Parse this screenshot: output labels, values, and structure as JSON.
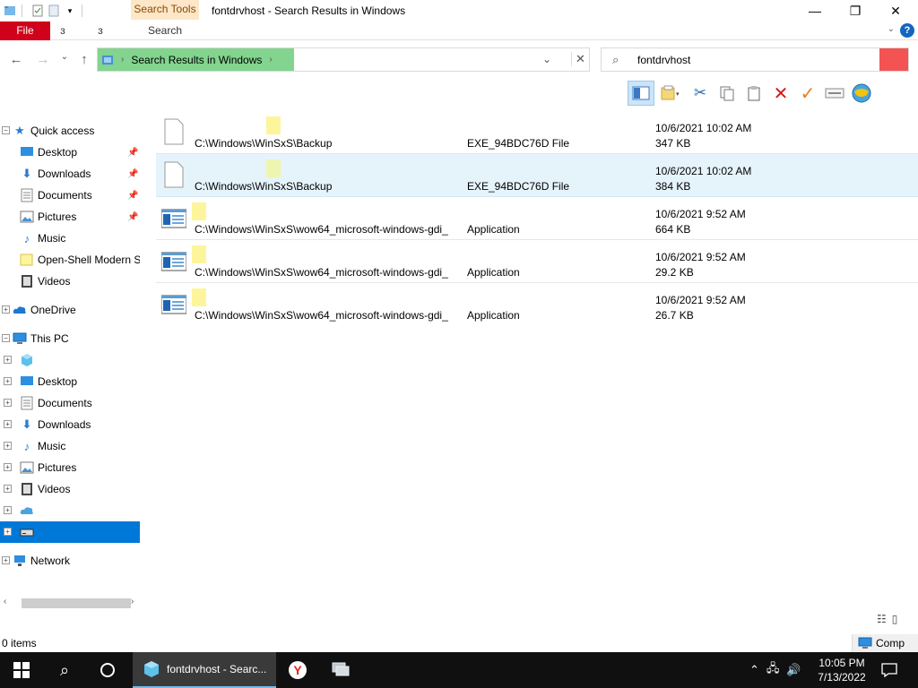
{
  "window": {
    "title": "fontdrvhost - Search Results in Windows",
    "context_tab": "Search Tools",
    "minimize": "—",
    "maximize": "❐",
    "close": "✕"
  },
  "ribbon": {
    "file_label": "File",
    "tab_home": "ɜ",
    "tab_share": "ɜ",
    "tab_search": "Search",
    "help": "?"
  },
  "address": {
    "crumb": "Search Results in Windows",
    "search_value": "fontdrvhost"
  },
  "nav": {
    "quick_access": "Quick access",
    "qa_items": [
      "Desktop",
      "Downloads",
      "Documents",
      "Pictures",
      "Music",
      "Open-Shell Modern S",
      "Videos"
    ],
    "onedrive": "OneDrive",
    "this_pc": "This PC",
    "pc_items": [
      "Desktop",
      "Documents",
      "Downloads",
      "Music",
      "Pictures",
      "Videos"
    ],
    "network": "Network"
  },
  "files": [
    {
      "path": "C:\\Windows\\WinSxS\\Backup",
      "type": "EXE_94BDC76D File",
      "date": "10/6/2021 10:02 AM",
      "size": "347 KB"
    },
    {
      "path": "C:\\Windows\\WinSxS\\Backup",
      "type": "EXE_94BDC76D File",
      "date": "10/6/2021 10:02 AM",
      "size": "384 KB"
    },
    {
      "path": "C:\\Windows\\WinSxS\\wow64_microsoft-windows-gdi_",
      "type": "Application",
      "date": "10/6/2021 9:52 AM",
      "size": "664 KB"
    },
    {
      "path": "C:\\Windows\\WinSxS\\wow64_microsoft-windows-gdi_",
      "type": "Application",
      "date": "10/6/2021 9:52 AM",
      "size": "29.2 KB"
    },
    {
      "path": "C:\\Windows\\WinSxS\\wow64_microsoft-windows-gdi_",
      "type": "Application",
      "date": "10/6/2021 9:52 AM",
      "size": "26.7 KB"
    }
  ],
  "status": {
    "items": "0 items",
    "comp": "Comp"
  },
  "taskbar": {
    "app_label": "fontdrvhost - Searc...",
    "time": "10:05 PM",
    "date": "7/13/2022"
  },
  "colors": {
    "accent": "#0078d7",
    "file_tab": "#d0021b",
    "address_green": "#82d48e",
    "search_red": "#f35353",
    "highlight": "#fdf59c"
  }
}
